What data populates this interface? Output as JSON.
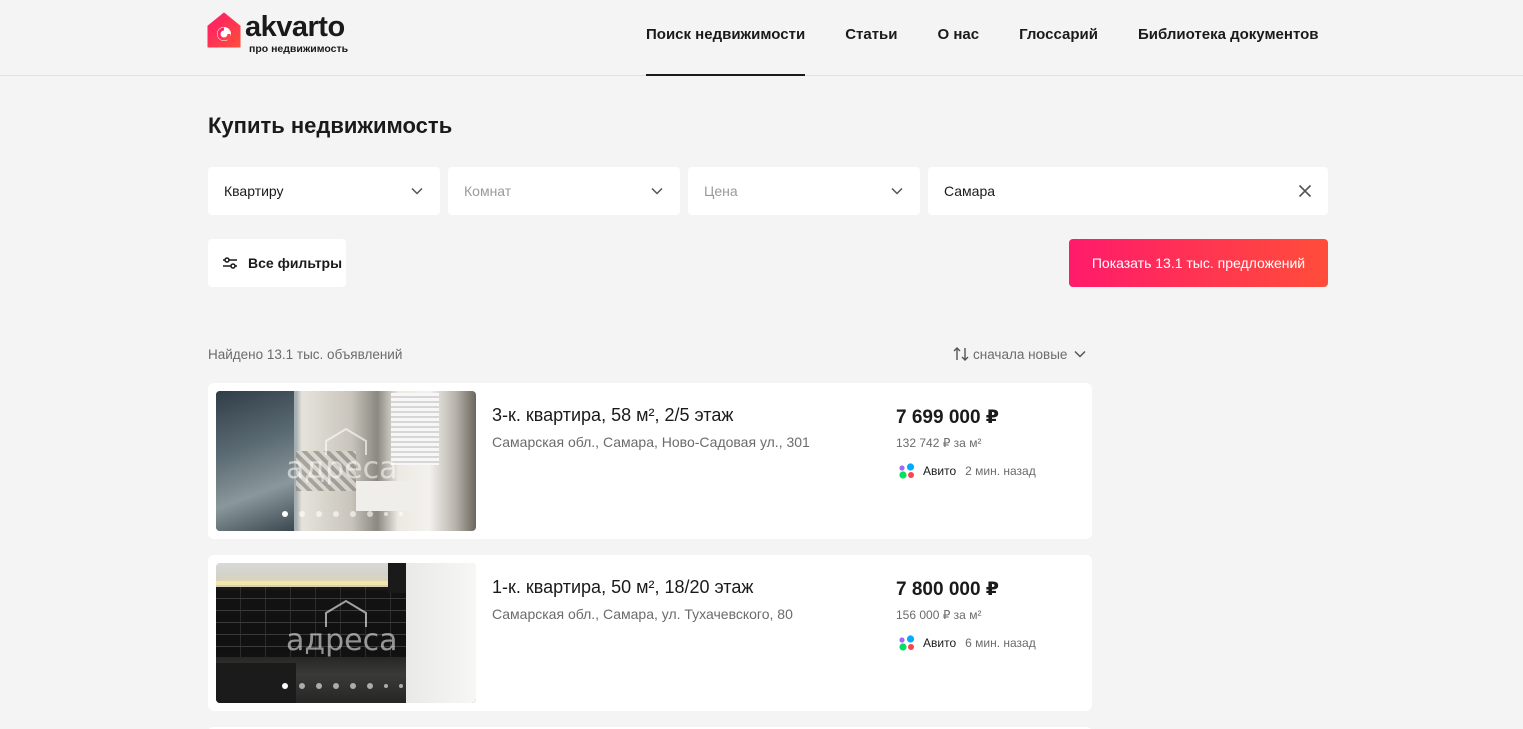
{
  "header": {
    "logo_word": "akvarto",
    "logo_sub": "про недвижимость",
    "nav": [
      {
        "label": "Поиск недвижимости",
        "active": true
      },
      {
        "label": "Статьи"
      },
      {
        "label": "О нас"
      },
      {
        "label": "Глоссарий"
      },
      {
        "label": "Библиотека документов"
      }
    ]
  },
  "page_title": "Купить недвижимость",
  "search": {
    "type_value": "Квартиру",
    "rooms_placeholder": "Комнат",
    "price_placeholder": "Цена",
    "city_value": "Самара",
    "filters_label": "Все фильтры",
    "show_label": "Показать 13.1 тыс. предложений"
  },
  "results": {
    "found_text": "Найдено 13.1 тыс. объявлений",
    "sort_label": "сначала новые"
  },
  "listings": [
    {
      "title": "3-к. квартира, 58 м², 2/5 этаж",
      "address": "Самарская обл., Самара, Ново-Садовая ул., 301",
      "price": "7 699 000 ₽",
      "price_per_m2": "132 742 ₽ за м²",
      "source": "Авито",
      "time": "2 мин. назад",
      "watermark": "адреса"
    },
    {
      "title": "1-к. квартира, 50 м², 18/20 этаж",
      "address": "Самарская обл., Самара, ул. Тухачевского, 80",
      "price": "7 800 000 ₽",
      "price_per_m2": "156 000 ₽ за м²",
      "source": "Авито",
      "time": "6 мин. назад",
      "watermark": "адреса"
    }
  ],
  "colors": {
    "accent_start": "#ff1a6b",
    "accent_end": "#ff4d3a"
  }
}
